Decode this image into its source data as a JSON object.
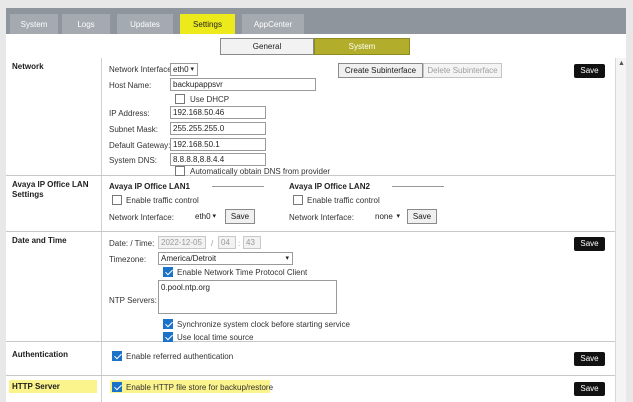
{
  "tabs": [
    {
      "label": "System"
    },
    {
      "label": "Logs"
    },
    {
      "label": "Updates"
    },
    {
      "label": "Settings"
    },
    {
      "label": "AppCenter"
    }
  ],
  "subtabs": {
    "general": "General",
    "system": "System"
  },
  "colors": {
    "accent": "#ecea1b",
    "highlight": "#fbf38c",
    "checkbox": "#1a73c8"
  },
  "network": {
    "title": "Network",
    "interface_label": "Network Interface:",
    "interface_value": "eth0",
    "create_sub": "Create Subinterface",
    "delete_sub": "Delete Subinterface",
    "host_label": "Host Name:",
    "host_value": "backupappsvr",
    "dhcp": "Use DHCP",
    "ip_label": "IP Address:",
    "ip_value": "192.168.50.46",
    "mask_label": "Subnet Mask:",
    "mask_value": "255.255.255.0",
    "gw_label": "Default Gateway:",
    "gw_value": "192.168.50.1",
    "dns_label": "System DNS:",
    "dns_value": "8.8.8.8,8.8.4.4",
    "auto_dns": "Automatically obtain DNS from provider",
    "save": "Save"
  },
  "lan": {
    "title": "Avaya IP Office LAN Settings",
    "lan1": {
      "title": "Avaya IP Office LAN1",
      "traffic": "Enable traffic control",
      "iface_label": "Network Interface:",
      "iface_value": "eth0",
      "save": "Save"
    },
    "lan2": {
      "title": "Avaya IP Office LAN2",
      "traffic": "Enable traffic control",
      "iface_label": "Network Interface:",
      "iface_value": "none",
      "save": "Save"
    }
  },
  "datetime": {
    "title": "Date and Time",
    "date_label": "Date: / Time:",
    "date_value": "2022-12-05",
    "sep": "/",
    "hour": "04",
    "colon": ":",
    "minute": "43",
    "tz_label": "Timezone:",
    "tz_value": "America/Detroit",
    "ntp_client": "Enable Network Time Protocol Client",
    "ntp_servers_label": "NTP Servers:",
    "ntp_servers_value": "0.pool.ntp.org",
    "sync": "Synchronize system clock before starting service",
    "local": "Use local time source",
    "save": "Save"
  },
  "auth": {
    "title": "Authentication",
    "referred": "Enable referred authentication",
    "save": "Save"
  },
  "http": {
    "title": "HTTP Server",
    "filestore": "Enable HTTP file store for backup/restore",
    "save": "Save"
  }
}
